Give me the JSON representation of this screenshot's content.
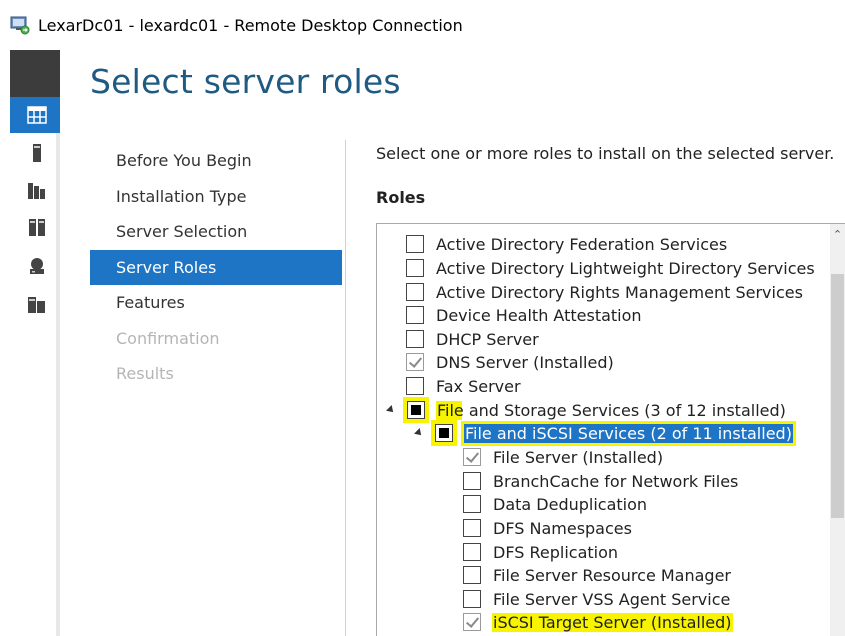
{
  "window": {
    "title": "LexarDc01 - lexardc01 - Remote Desktop Connection"
  },
  "wizard": {
    "title": "Select server roles",
    "steps": [
      {
        "label": "Before You Begin",
        "state": "normal"
      },
      {
        "label": "Installation Type",
        "state": "normal"
      },
      {
        "label": "Server Selection",
        "state": "normal"
      },
      {
        "label": "Server Roles",
        "state": "active"
      },
      {
        "label": "Features",
        "state": "normal"
      },
      {
        "label": "Confirmation",
        "state": "disabled"
      },
      {
        "label": "Results",
        "state": "disabled"
      }
    ],
    "instruction": "Select one or more roles to install on the selected server.",
    "roles_label": "Roles",
    "roles": [
      {
        "label": "Active Directory Federation Services",
        "state": "unchecked"
      },
      {
        "label": "Active Directory Lightweight Directory Services",
        "state": "unchecked"
      },
      {
        "label": "Active Directory Rights Management Services",
        "state": "unchecked"
      },
      {
        "label": "Device Health Attestation",
        "state": "unchecked"
      },
      {
        "label": "DHCP Server",
        "state": "unchecked"
      },
      {
        "label": "DNS Server (Installed)",
        "state": "checked"
      },
      {
        "label": "Fax Server",
        "state": "unchecked"
      },
      {
        "label": "File and Storage Services (3 of 12 installed)",
        "state": "partial"
      },
      {
        "label": "File and iSCSI Services (2 of 11 installed)",
        "state": "partial"
      },
      {
        "label": "File Server (Installed)",
        "state": "checked"
      },
      {
        "label": "BranchCache for Network Files",
        "state": "unchecked"
      },
      {
        "label": "Data Deduplication",
        "state": "unchecked"
      },
      {
        "label": "DFS Namespaces",
        "state": "unchecked"
      },
      {
        "label": "DFS Replication",
        "state": "unchecked"
      },
      {
        "label": "File Server Resource Manager",
        "state": "unchecked"
      },
      {
        "label": "File Server VSS Agent Service",
        "state": "unchecked"
      },
      {
        "label": "iSCSI Target Server (Installed)",
        "state": "checked"
      }
    ]
  },
  "colors": {
    "accent": "#1e74c5",
    "highlight": "#f8f400",
    "title": "#1f5a83"
  }
}
